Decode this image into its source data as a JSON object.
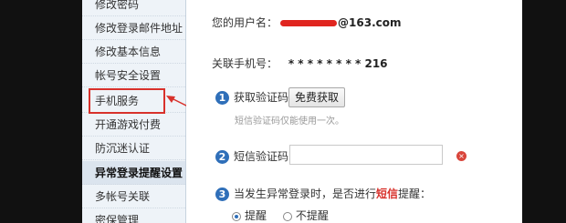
{
  "sidebar": {
    "items": [
      {
        "label": "修改密码"
      },
      {
        "label": "修改登录邮件地址"
      },
      {
        "label": "修改基本信息"
      },
      {
        "label": "帐号安全设置"
      },
      {
        "label": "手机服务"
      },
      {
        "label": "开通游戏付费"
      },
      {
        "label": "防沉迷认证"
      },
      {
        "label": "异常登录提醒设置"
      },
      {
        "label": "多帐号关联"
      },
      {
        "label": "密保管理"
      }
    ],
    "active_index": 7,
    "highlighted_index": 4
  },
  "account": {
    "username_label": "您的用户名：",
    "username_suffix": "@163.com",
    "phone_label": "关联手机号：",
    "phone_value": "* * * * * * * * 216"
  },
  "steps": {
    "step1": {
      "num": "1",
      "label": "获取验证码：",
      "button": "免费获取",
      "hint": "短信验证码仅能使用一次。"
    },
    "step2": {
      "num": "2",
      "label": "短信验证码：",
      "error_icon": "×"
    },
    "step3": {
      "num": "3",
      "text_before": "当发生异常登录时，是否进行",
      "text_highlight": "短信",
      "text_after": "提醒：",
      "option_on": "提醒",
      "option_off": "不提醒"
    }
  },
  "colors": {
    "accent": "#2f6fb9",
    "highlight": "#d8312b"
  }
}
